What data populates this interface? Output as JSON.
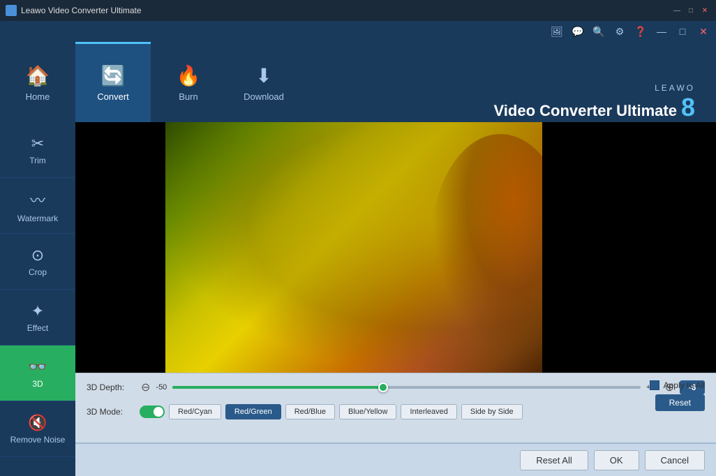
{
  "app": {
    "title": "Leawo Video Converter Ultimate",
    "icon": "🎬"
  },
  "titlebar": {
    "title": "Leawo Video Converter Ultimate",
    "minimize": "—",
    "maximize": "□",
    "close": "✕"
  },
  "top_icons": [
    "🖼",
    "💬",
    "🔍",
    "⚙",
    "❓"
  ],
  "brand": {
    "leawo": "LEAWO",
    "product_name": "Video Converter Ultimate",
    "version": "8"
  },
  "nav_tabs": [
    {
      "id": "home",
      "label": "Home",
      "icon": "🏠",
      "active": false
    },
    {
      "id": "convert",
      "label": "Convert",
      "icon": "🔄",
      "active": true
    },
    {
      "id": "burn",
      "label": "Burn",
      "icon": "🔥",
      "active": false
    },
    {
      "id": "download",
      "label": "Download",
      "icon": "⬇",
      "active": false
    }
  ],
  "sidebar": {
    "items": [
      {
        "id": "trim",
        "label": "Trim",
        "icon": "✂",
        "active": false
      },
      {
        "id": "watermark",
        "label": "Watermark",
        "icon": "〰",
        "active": false
      },
      {
        "id": "crop",
        "label": "Crop",
        "icon": "⊙",
        "active": false
      },
      {
        "id": "effect",
        "label": "Effect",
        "icon": "✦",
        "active": false
      },
      {
        "id": "3d",
        "label": "3D",
        "icon": "👓",
        "active": true
      },
      {
        "id": "remove-noise",
        "label": "Remove Noise",
        "icon": "🔇",
        "active": false
      }
    ]
  },
  "controls": {
    "depth_label": "3D Depth:",
    "depth_min": "-50",
    "depth_max": "+50",
    "depth_value": "-6",
    "apply_to_all": "Apply to All",
    "reset": "Reset",
    "mode_label": "3D Mode:",
    "mode_options": [
      {
        "id": "red-cyan",
        "label": "Red/Cyan",
        "active": false
      },
      {
        "id": "red-green",
        "label": "Red/Green",
        "active": true
      },
      {
        "id": "red-blue",
        "label": "Red/Blue",
        "active": false
      },
      {
        "id": "blue-yellow",
        "label": "Blue/Yellow",
        "active": false
      },
      {
        "id": "interleaved",
        "label": "Interleaved",
        "active": false
      },
      {
        "id": "side-by-side",
        "label": "Side by Side",
        "active": false
      }
    ]
  },
  "bottom_bar": {
    "reset_all": "Reset All",
    "ok": "OK",
    "cancel": "Cancel"
  }
}
